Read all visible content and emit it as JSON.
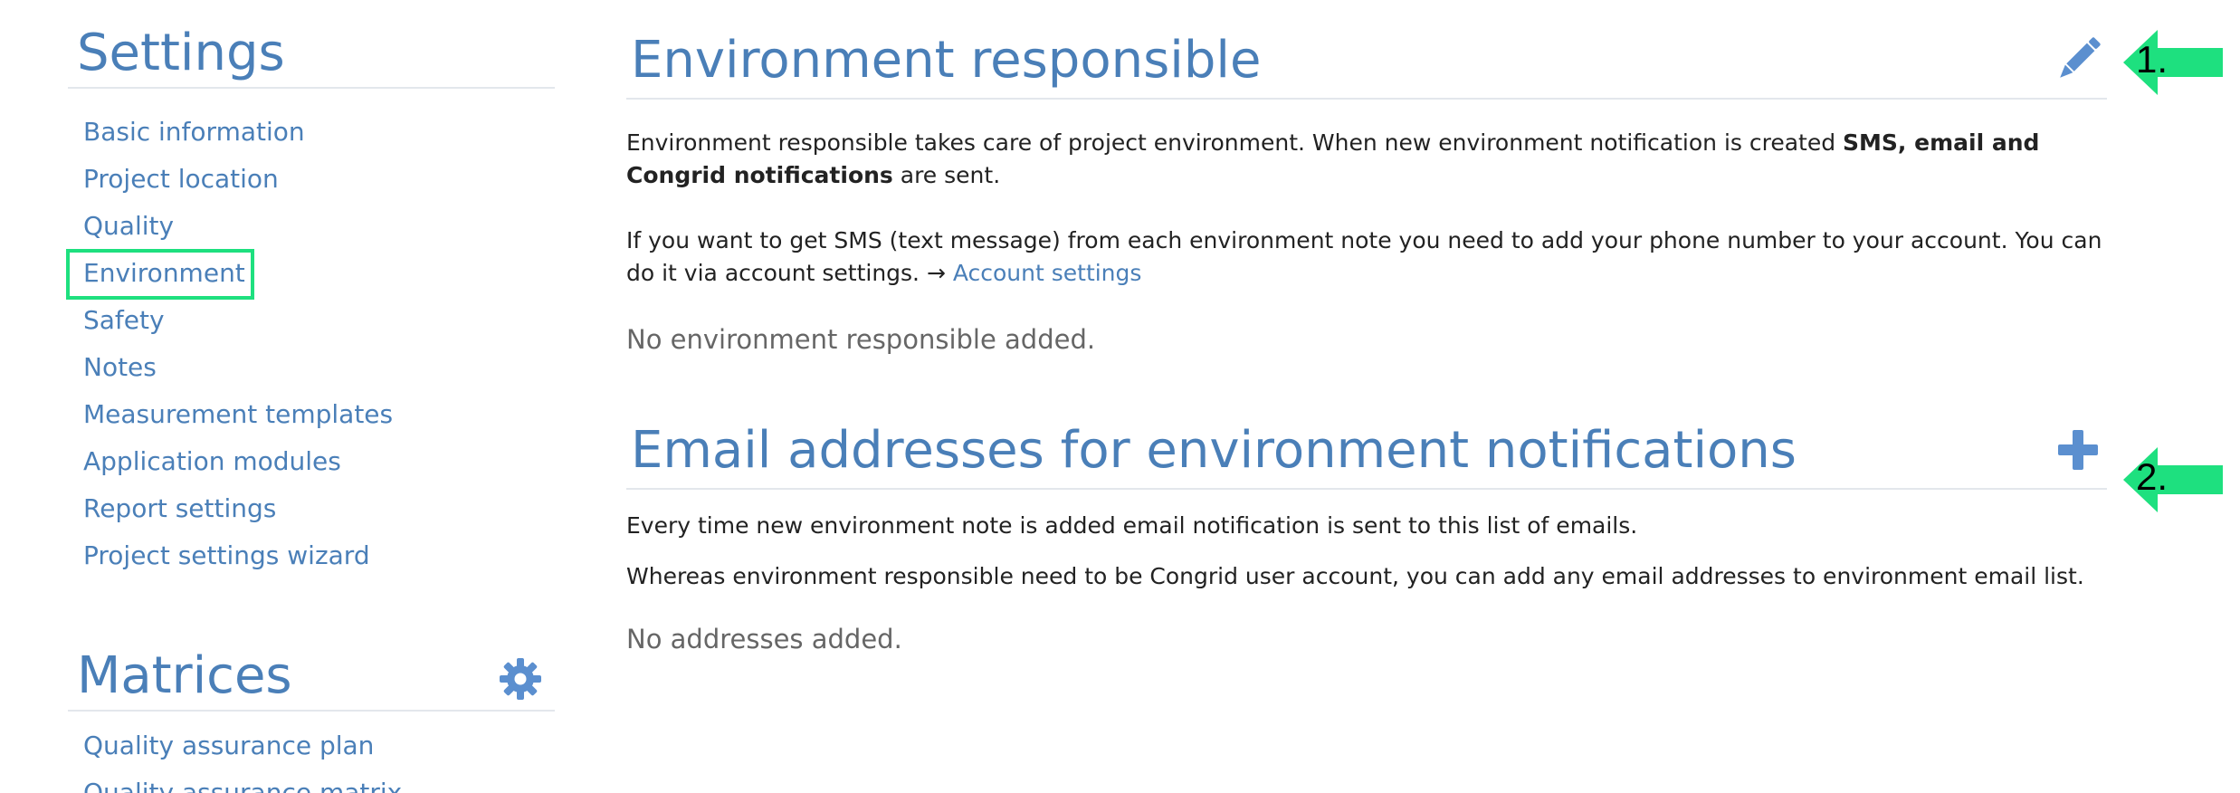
{
  "sidebar": {
    "settings_title": "Settings",
    "settings_items": [
      {
        "label": "Basic information"
      },
      {
        "label": "Project location"
      },
      {
        "label": "Quality"
      },
      {
        "label": "Environment"
      },
      {
        "label": "Safety"
      },
      {
        "label": "Notes"
      },
      {
        "label": "Measurement templates"
      },
      {
        "label": "Application modules"
      },
      {
        "label": "Report settings"
      },
      {
        "label": "Project settings wizard"
      }
    ],
    "matrices_title": "Matrices",
    "matrices_items": [
      {
        "label": "Quality assurance plan"
      },
      {
        "label": "Quality assurance matrix"
      }
    ],
    "gear_icon": "gear-icon"
  },
  "responsible": {
    "title": "Environment responsible",
    "p1_text": "Environment responsible takes care of project environment. When new environment notification is created ",
    "p1_bold": "SMS, email and Congrid notifications",
    "p1_end": " are sent.",
    "p2_text": "If you want to get SMS (text message) from each environment note you need to add your phone number to your account. You can do it via account settings. → ",
    "p2_link": "Account settings",
    "empty": "No environment responsible added.",
    "edit_icon": "pencil-icon"
  },
  "emails": {
    "title": "Email addresses for environment notifications",
    "p1": "Every time new environment note is added email notification is sent to this list of emails.",
    "p2": "Whereas environment responsible need to be Congrid user account, you can add any email addresses to environment email list.",
    "empty": "No addresses added.",
    "add_icon": "plus-icon"
  },
  "annotations": {
    "label1": "1.",
    "label2": "2.",
    "color": "#1ee07f"
  },
  "colors": {
    "link": "#4a7fb8",
    "heading": "#4a7fb8",
    "highlight": "#1ee07f"
  }
}
